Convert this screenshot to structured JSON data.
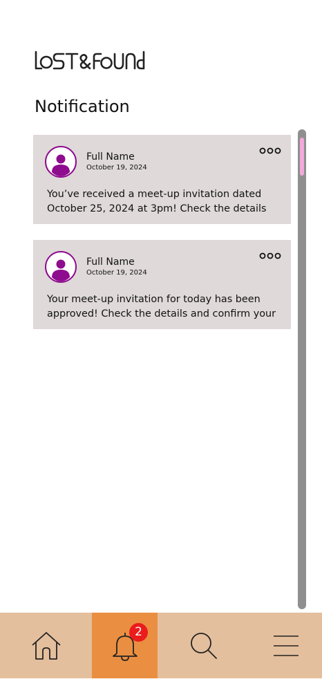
{
  "app": {
    "logo_text": "LOST&FOUND"
  },
  "page": {
    "title": "Notification"
  },
  "notifications": [
    {
      "name": "Full Name",
      "date": "October 19, 2024",
      "message": "You’ve received a meet-up invitation dated October 25, 2024 at 3pm! Check the details and"
    },
    {
      "name": "Full Name",
      "date": "October 19, 2024",
      "message": "Your meet-up invitation for today has been approved! Check the details and confirm your"
    }
  ],
  "nav": {
    "items": [
      {
        "icon": "home-icon",
        "active": false
      },
      {
        "icon": "bell-icon",
        "active": true,
        "badge": "2"
      },
      {
        "icon": "search-icon",
        "active": false
      },
      {
        "icon": "menu-icon",
        "active": false
      }
    ]
  },
  "colors": {
    "card_bg": "#dfd9d9",
    "nav_bg": "#e4bf9d",
    "nav_active": "#ea8f41",
    "badge": "#ea1c1c",
    "avatar": "#8e0c8e",
    "scroll_thumb": "#f3a9da"
  }
}
